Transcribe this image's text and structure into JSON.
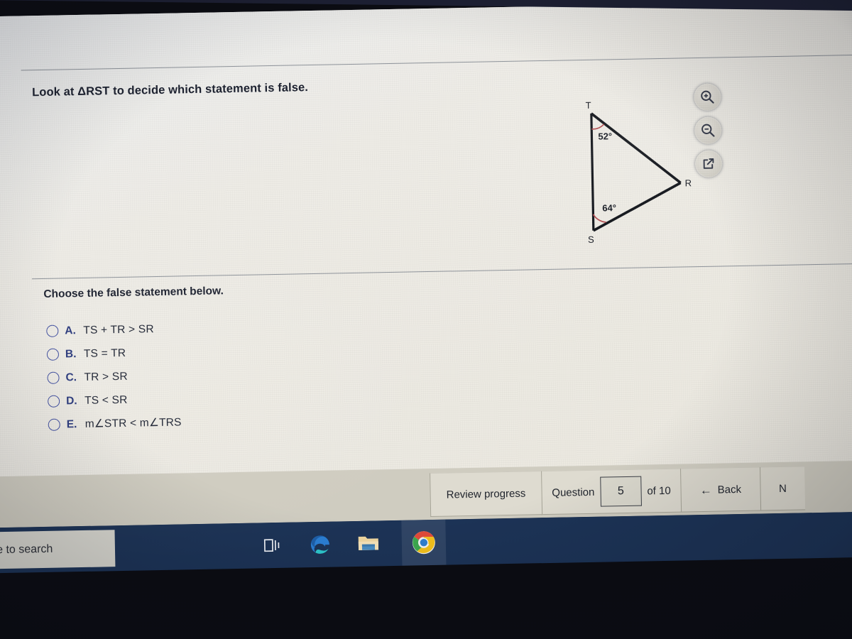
{
  "prompt": "Look at ΔRST to decide which statement is false.",
  "subprompt": "Choose the false statement below.",
  "choices": [
    {
      "letter": "A.",
      "text": "TS + TR > SR"
    },
    {
      "letter": "B.",
      "text": "TS = TR"
    },
    {
      "letter": "C.",
      "text": "TR > SR"
    },
    {
      "letter": "D.",
      "text": "TS < SR"
    },
    {
      "letter": "E.",
      "text": "m∠STR < m∠TRS"
    }
  ],
  "figure": {
    "vertices": {
      "T": "T",
      "R": "R",
      "S": "S"
    },
    "angles": {
      "at_T": "52°",
      "at_S": "64°"
    },
    "arc_color": "#b0484c",
    "line_color": "#0d1016"
  },
  "figure_tools": [
    {
      "name": "zoom-in-icon",
      "label": "Zoom in"
    },
    {
      "name": "zoom-out-icon",
      "label": "Zoom out"
    },
    {
      "name": "open-in-new-window-icon",
      "label": "Open in new window"
    }
  ],
  "navbar": {
    "review_label": "Review progress",
    "question_label": "Question",
    "question_number": "5",
    "of_label": "of 10",
    "back_arrow": "←",
    "back_label": "Back",
    "next_label": "N"
  },
  "taskbar": {
    "search_placeholder": "ere to search",
    "items": [
      {
        "name": "task-view-icon"
      },
      {
        "name": "microsoft-edge-icon"
      },
      {
        "name": "file-explorer-icon"
      },
      {
        "name": "google-chrome-icon"
      }
    ]
  },
  "colors": {
    "accent_blue": "#26367a",
    "taskbar": "#1c3356",
    "navbar": "#cfccc0",
    "paper": "#ebe8df"
  }
}
